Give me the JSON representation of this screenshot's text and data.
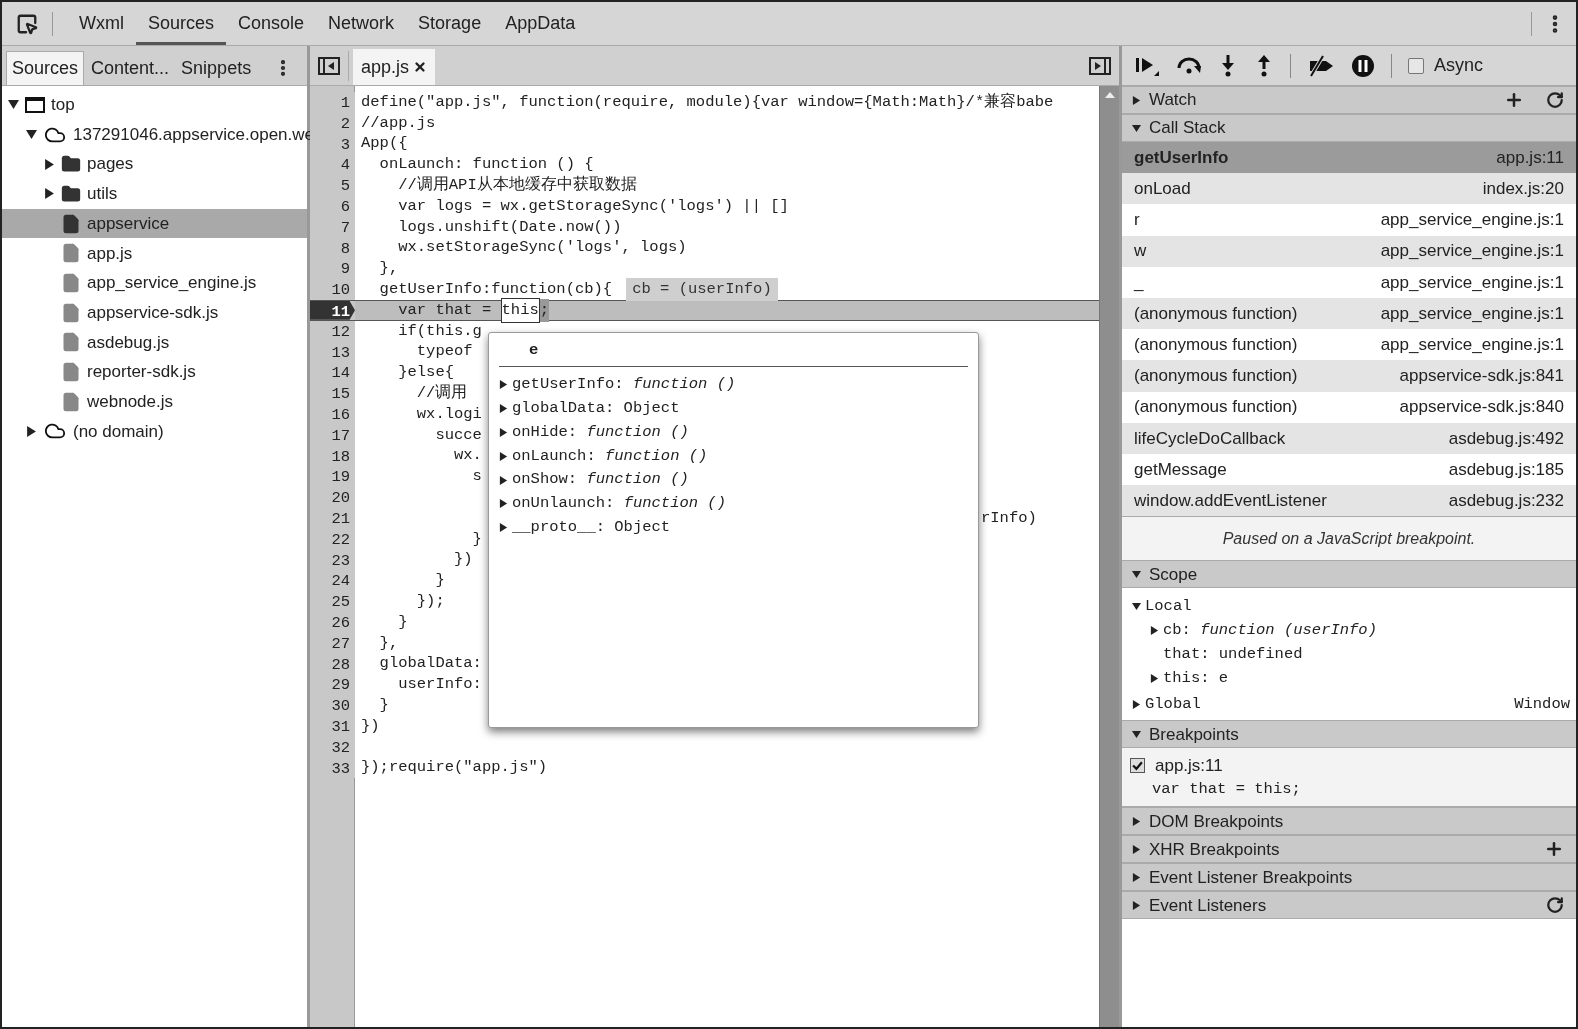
{
  "main_tabs": [
    {
      "label": "Wxml",
      "selected": false
    },
    {
      "label": "Sources",
      "selected": true
    },
    {
      "label": "Console",
      "selected": false
    },
    {
      "label": "Network",
      "selected": false
    },
    {
      "label": "Storage",
      "selected": false
    },
    {
      "label": "AppData",
      "selected": false
    }
  ],
  "navigator": {
    "tabs": [
      {
        "label": "Sources",
        "selected": true
      },
      {
        "label": "Content...",
        "selected": false
      },
      {
        "label": "Snippets",
        "selected": false
      }
    ],
    "tree": [
      {
        "label": "top",
        "kind": "frame",
        "expanded": true,
        "selected": false,
        "children": [
          {
            "label": "137291046.appservice.open.we",
            "kind": "domain",
            "expanded": true,
            "selected": false,
            "children": [
              {
                "label": "pages",
                "kind": "folder",
                "expanded": false,
                "selected": false
              },
              {
                "label": "utils",
                "kind": "folder",
                "expanded": false,
                "selected": false
              },
              {
                "label": "appservice",
                "kind": "file",
                "selected": true
              },
              {
                "label": "app.js",
                "kind": "file",
                "selected": false
              },
              {
                "label": "app_service_engine.js",
                "kind": "file",
                "selected": false
              },
              {
                "label": "appservice-sdk.js",
                "kind": "file",
                "selected": false
              },
              {
                "label": "asdebug.js",
                "kind": "file",
                "selected": false
              },
              {
                "label": "reporter-sdk.js",
                "kind": "file",
                "selected": false
              },
              {
                "label": "webnode.js",
                "kind": "file",
                "selected": false
              }
            ]
          },
          {
            "label": "(no domain)",
            "kind": "domain",
            "expanded": false,
            "selected": false
          }
        ]
      }
    ]
  },
  "editor": {
    "tabs": [
      {
        "label": "app.js",
        "selected": true
      }
    ],
    "lines": [
      {
        "number": "1",
        "text": "define(\"app.js\", function(require, module){var window={Math:Math}/*兼容babe",
        "current": false
      },
      {
        "number": "2",
        "text": "//app.js",
        "current": false
      },
      {
        "number": "3",
        "text": "App({",
        "current": false
      },
      {
        "number": "4",
        "text": "  onLaunch: function () {",
        "current": false
      },
      {
        "number": "5",
        "text": "    //调用API从本地缓存中获取数据",
        "current": false
      },
      {
        "number": "6",
        "text": "    var logs = wx.getStorageSync('logs') || []",
        "current": false
      },
      {
        "number": "7",
        "text": "    logs.unshift(Date.now())",
        "current": false
      },
      {
        "number": "8",
        "text": "    wx.setStorageSync('logs', logs)",
        "current": false
      },
      {
        "number": "9",
        "text": "  },",
        "current": false
      },
      {
        "number": "10",
        "text": "  getUserInfo:function(cb){",
        "inline_value": "cb = (userInfo)",
        "current": false
      },
      {
        "number": "11",
        "text": "    var that = ",
        "hovered": "this",
        "after": ";",
        "current": true
      },
      {
        "number": "12",
        "text": "    if(this.g",
        "current": false
      },
      {
        "number": "13",
        "text": "      typeof",
        "current": false
      },
      {
        "number": "14",
        "text": "    }else{",
        "current": false
      },
      {
        "number": "15",
        "text": "      //调用",
        "current": false
      },
      {
        "number": "16",
        "text": "      wx.logi",
        "current": false
      },
      {
        "number": "17",
        "text": "        succe",
        "current": false
      },
      {
        "number": "18",
        "text": "          wx.",
        "current": false
      },
      {
        "number": "19",
        "text": "            s",
        "current": false
      },
      {
        "number": "20",
        "current": false
      },
      {
        "number": "21",
        "tail": "rInfo)",
        "current": false
      },
      {
        "number": "22",
        "text": "            }",
        "current": false
      },
      {
        "number": "23",
        "text": "          })",
        "current": false
      },
      {
        "number": "24",
        "text": "        }",
        "current": false
      },
      {
        "number": "25",
        "text": "      });",
        "current": false
      },
      {
        "number": "26",
        "text": "    }",
        "current": false
      },
      {
        "number": "27",
        "text": "  },",
        "current": false
      },
      {
        "number": "28",
        "text": "  globalData:",
        "current": false
      },
      {
        "number": "29",
        "text": "    userInfo:",
        "current": false
      },
      {
        "number": "30",
        "text": "  }",
        "current": false
      },
      {
        "number": "31",
        "text": "})",
        "current": false
      },
      {
        "number": "32",
        "current": false
      },
      {
        "number": "33",
        "text": "});require(\"app.js\")",
        "current": false
      }
    ],
    "popover": {
      "title": "e",
      "properties": [
        {
          "text": "getUserInfo: *function ()*"
        },
        {
          "text": "globalData: Object"
        },
        {
          "text": "onHide: *function ()*"
        },
        {
          "text": "onLaunch: *function ()*"
        },
        {
          "text": "onShow: *function ()*"
        },
        {
          "text": "onUnlaunch: *function ()*"
        },
        {
          "text": "__proto__: Object"
        }
      ]
    }
  },
  "debugger": {
    "async": {
      "label": "Async",
      "checked": false
    },
    "sections": [
      {
        "kind": "watch",
        "title": "Watch",
        "expanded": false
      },
      {
        "kind": "callstack",
        "title": "Call Stack",
        "expanded": true,
        "frames": [
          {
            "name": "getUserInfo",
            "location": "app.js:11",
            "selected": true
          },
          {
            "name": "onLoad",
            "location": "index.js:20",
            "selected": false
          },
          {
            "name": "r",
            "location": "app_service_engine.js:1",
            "selected": false
          },
          {
            "name": "w",
            "location": "app_service_engine.js:1",
            "selected": false
          },
          {
            "name": "_",
            "location": "app_service_engine.js:1",
            "selected": false
          },
          {
            "name": "(anonymous function)",
            "location": "app_service_engine.js:1",
            "selected": false
          },
          {
            "name": "(anonymous function)",
            "location": "app_service_engine.js:1",
            "selected": false
          },
          {
            "name": "(anonymous function)",
            "location": "appservice-sdk.js:841",
            "selected": false
          },
          {
            "name": "(anonymous function)",
            "location": "appservice-sdk.js:840",
            "selected": false
          },
          {
            "name": "lifeCycleDoCallback",
            "location": "asdebug.js:492",
            "selected": false
          },
          {
            "name": "getMessage",
            "location": "asdebug.js:185",
            "selected": false
          },
          {
            "name": "window.addEventListener",
            "location": "asdebug.js:232",
            "selected": false
          }
        ],
        "status": "Paused on a JavaScript breakpoint."
      },
      {
        "kind": "scope",
        "title": "Scope",
        "expanded": true,
        "scopes": [
          {
            "name": "Local",
            "expanded": true,
            "variables": [
              {
                "text": "cb: *function (userInfo)*",
                "expandable": true
              },
              {
                "text": "that: undefined",
                "expandable": false
              },
              {
                "text": "this: e",
                "expandable": true
              }
            ]
          },
          {
            "name": "Global",
            "expanded": false,
            "value": "Window"
          }
        ]
      },
      {
        "kind": "breakpoints",
        "title": "Breakpoints",
        "expanded": true,
        "breakpoints": [
          {
            "location": "app.js:11",
            "code": "var that = this;",
            "checked": true
          }
        ]
      },
      {
        "kind": "dom",
        "title": "DOM Breakpoints",
        "expanded": false
      },
      {
        "kind": "xhr",
        "title": "XHR Breakpoints",
        "expanded": false
      },
      {
        "kind": "event_breakpoints",
        "title": "Event Listener Breakpoints",
        "expanded": false
      },
      {
        "kind": "listeners",
        "title": "Event Listeners",
        "expanded": false
      }
    ]
  }
}
